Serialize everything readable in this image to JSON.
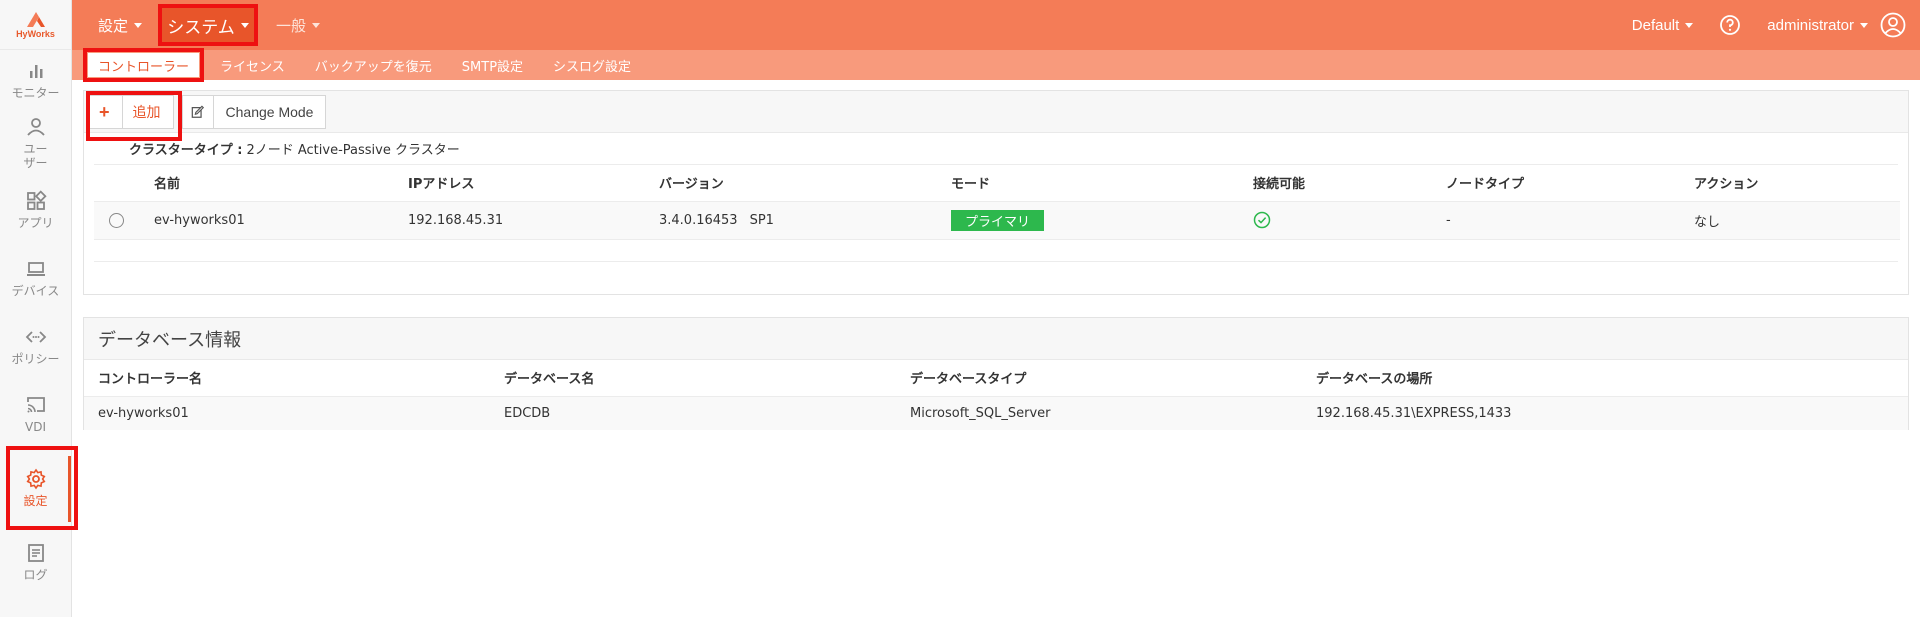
{
  "brand": {
    "name": "HyWorks",
    "accent": "#f47c57",
    "highlight": "#ee1111"
  },
  "sidebar": {
    "items": [
      {
        "label": "モニター",
        "icon": "bar-chart-icon"
      },
      {
        "label": "ユーザー",
        "icon": "user-icon"
      },
      {
        "label": "アプリ",
        "icon": "apps-grid-icon"
      },
      {
        "label": "デバイス",
        "icon": "laptop-icon"
      },
      {
        "label": "ポリシー",
        "icon": "code-arrows-icon"
      },
      {
        "label": "VDI",
        "icon": "cast-icon"
      },
      {
        "label": "設定",
        "icon": "gear-icon",
        "active": true
      },
      {
        "label": "ログ",
        "icon": "log-document-icon"
      }
    ]
  },
  "topbar": {
    "menu": [
      "設定",
      "システム",
      "一般"
    ],
    "active_menu": "システム",
    "tenant": "Default",
    "help_icon": "question-circle-icon",
    "user": "administrator",
    "user_icon": "user-circle-icon"
  },
  "subtabs": [
    "コントローラー",
    "ライセンス",
    "バックアップを復元",
    "SMTP設定",
    "シスログ設定"
  ],
  "controllers": {
    "toolbar": {
      "add_label": "追加",
      "edit_icon": "edit-icon",
      "change_mode_label": "Change Mode"
    },
    "cluster_type_label": "クラスタータイプ :",
    "cluster_type_value": "2ノード Active-Passive クラスター",
    "columns": [
      "名前",
      "IPアドレス",
      "バージョン",
      "モード",
      "接続可能",
      "ノードタイプ",
      "アクション"
    ],
    "rows": [
      {
        "name": "ev-hyworks01",
        "ip": "192.168.45.31",
        "version": "3.4.0.16453",
        "sp": "SP1",
        "mode": "プライマリ",
        "mode_color": "#2db84d",
        "connectable_icon": "check-circle-icon",
        "node_type": "-",
        "action": "なし"
      }
    ]
  },
  "database": {
    "title": "データベース情報",
    "columns": [
      "コントローラー名",
      "データベース名",
      "データベースタイプ",
      "データベースの場所"
    ],
    "rows": [
      {
        "controller": "ev-hyworks01",
        "db_name": "EDCDB",
        "db_type": "Microsoft_SQL_Server",
        "location": "192.168.45.31\\EXPRESS,1433"
      }
    ]
  }
}
